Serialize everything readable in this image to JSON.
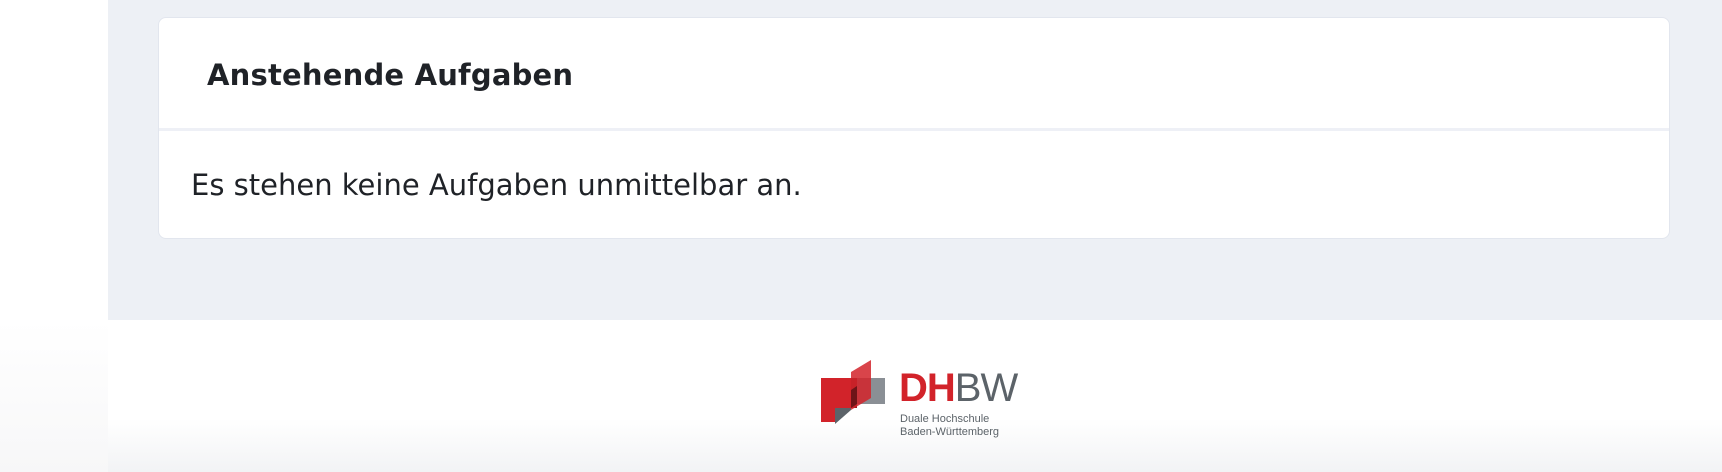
{
  "tasks_card": {
    "title": "Anstehende Aufgaben",
    "empty_message": "Es stehen keine Aufgaben unmittelbar an."
  },
  "footer": {
    "logo": {
      "wordmark_part1": "DH",
      "wordmark_part2": "BW",
      "subtitle_line1": "Duale Hochschule",
      "subtitle_line2": "Baden-Württemberg",
      "colors": {
        "red": "#d2232a",
        "dark_red": "#8f1a1f",
        "gray": "#5c6369"
      }
    }
  }
}
